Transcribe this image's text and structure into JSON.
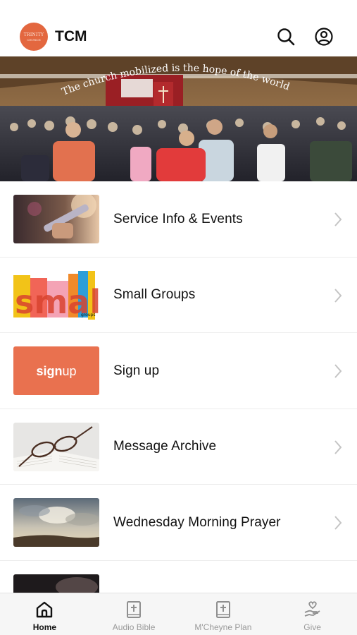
{
  "header": {
    "logo_top": "TRINITY",
    "logo_bottom": "CHURCH",
    "title": "TCM",
    "search_icon": "search-icon",
    "account_icon": "account-icon"
  },
  "hero": {
    "banner_text": "The church mobilized is the hope of the world!"
  },
  "menu": {
    "items": [
      {
        "label": "Service Info & Events",
        "icon": "chevron-right-icon"
      },
      {
        "label": "Small Groups",
        "icon": "chevron-right-icon",
        "thumb_text": "small",
        "thumb_sub": "groups"
      },
      {
        "label": "Sign up",
        "icon": "chevron-right-icon",
        "thumb_text_bold": "sign",
        "thumb_text_light": "up"
      },
      {
        "label": "Message Archive",
        "icon": "chevron-right-icon"
      },
      {
        "label": "Wednesday Morning Prayer",
        "icon": "chevron-right-icon"
      }
    ]
  },
  "tabs": [
    {
      "label": "Home",
      "icon": "home-icon",
      "active": true
    },
    {
      "label": "Audio Bible",
      "icon": "bible-icon",
      "active": false
    },
    {
      "label": "M'Cheyne Plan",
      "icon": "bible-plan-icon",
      "active": false
    },
    {
      "label": "Give",
      "icon": "give-heart-hand-icon",
      "active": false
    }
  ],
  "colors": {
    "brand": "#e3673f",
    "signup_bg": "#e9714f",
    "tab_active": "#111111",
    "tab_inactive": "#9a9a9a"
  }
}
